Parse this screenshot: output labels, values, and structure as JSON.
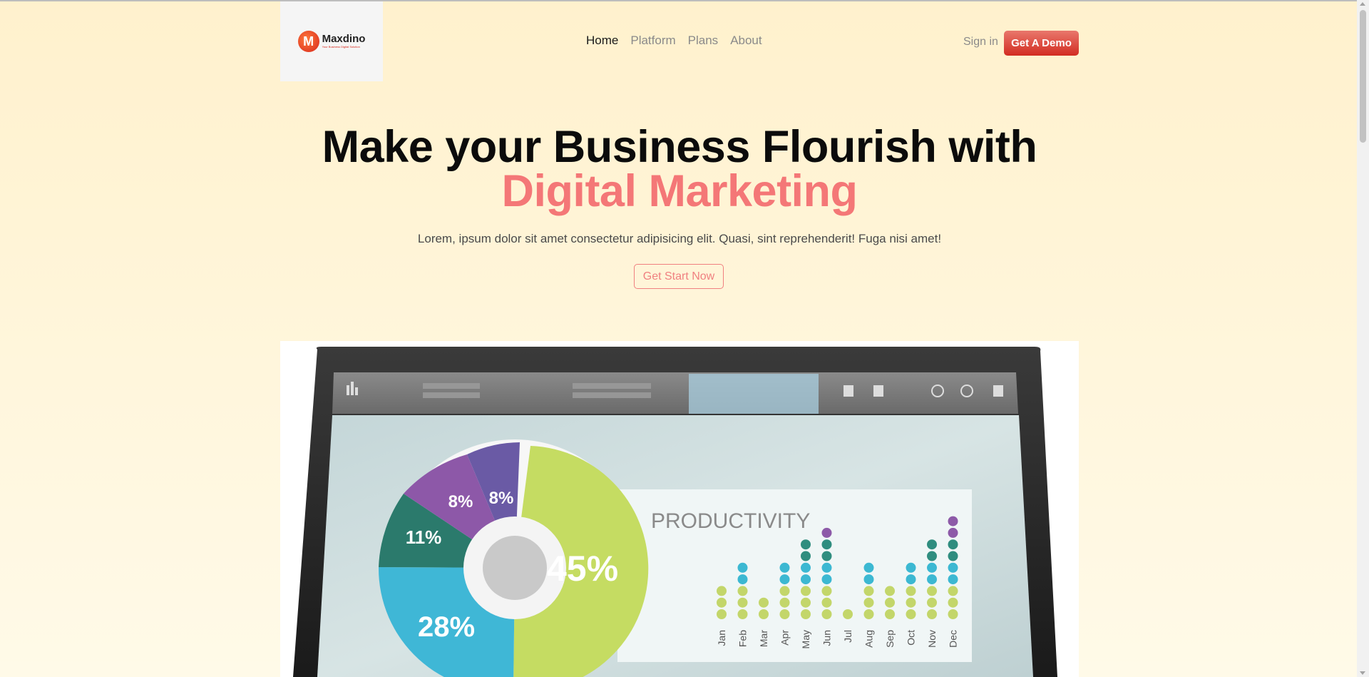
{
  "brand": {
    "name": "Maxdino",
    "tagline": "Your Business Digital Solution",
    "logo_letter": "M",
    "accent_color": "#f47777",
    "button_color": "#d22d22"
  },
  "nav": {
    "items": [
      {
        "label": "Home",
        "active": true
      },
      {
        "label": "Platform",
        "active": false
      },
      {
        "label": "Plans",
        "active": false
      },
      {
        "label": "About",
        "active": false
      }
    ]
  },
  "header": {
    "signin_label": "Sign in",
    "demo_label": "Get A Demo"
  },
  "hero": {
    "title_line1": "Make your Business Flourish with",
    "title_line2": "Digital Marketing",
    "subtitle": "Lorem, ipsum dolor sit amet consectetur adipisicing elit. Quasi, sint reprehenderit! Fuga nisi amet!",
    "cta_label": "Get Start Now"
  },
  "illustration": {
    "pie_labels": [
      "45%",
      "28%",
      "11%",
      "8%",
      "8%"
    ],
    "panel_title": "PRODUCTIVITY",
    "months": [
      "Jan",
      "Feb",
      "Mar",
      "Apr",
      "May",
      "Jun",
      "Jul",
      "Aug",
      "Sep",
      "Oct",
      "Nov",
      "Dec"
    ],
    "dot_counts": [
      3,
      5,
      2,
      5,
      7,
      8,
      1,
      5,
      3,
      5,
      7,
      9
    ]
  }
}
